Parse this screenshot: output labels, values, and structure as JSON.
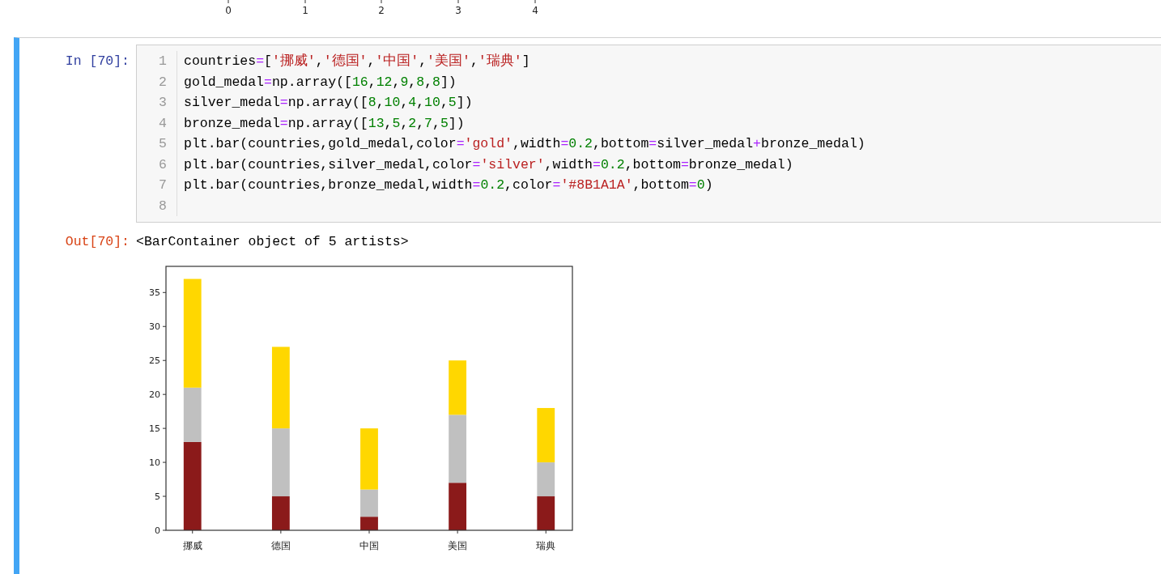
{
  "previous_output": {
    "x_tick_labels": [
      "0",
      "1",
      "2",
      "3",
      "4"
    ]
  },
  "cell": {
    "input": {
      "prompt": "In [70]:",
      "lines": [
        {
          "number": "1",
          "tokens": [
            {
              "kind": "name",
              "text": "countries"
            },
            {
              "kind": "op",
              "text": "="
            },
            {
              "kind": "name",
              "text": "["
            },
            {
              "kind": "string",
              "text": "'挪威'"
            },
            {
              "kind": "name",
              "text": ","
            },
            {
              "kind": "string",
              "text": "'德国'"
            },
            {
              "kind": "name",
              "text": ","
            },
            {
              "kind": "string",
              "text": "'中国'"
            },
            {
              "kind": "name",
              "text": ","
            },
            {
              "kind": "string",
              "text": "'美国'"
            },
            {
              "kind": "name",
              "text": ","
            },
            {
              "kind": "string",
              "text": "'瑞典'"
            },
            {
              "kind": "name",
              "text": "]"
            }
          ]
        },
        {
          "number": "2",
          "tokens": [
            {
              "kind": "name",
              "text": "gold_medal"
            },
            {
              "kind": "op",
              "text": "="
            },
            {
              "kind": "name",
              "text": "np.array(["
            },
            {
              "kind": "number",
              "text": "16"
            },
            {
              "kind": "name",
              "text": ","
            },
            {
              "kind": "number",
              "text": "12"
            },
            {
              "kind": "name",
              "text": ","
            },
            {
              "kind": "number",
              "text": "9"
            },
            {
              "kind": "name",
              "text": ","
            },
            {
              "kind": "number",
              "text": "8"
            },
            {
              "kind": "name",
              "text": ","
            },
            {
              "kind": "number",
              "text": "8"
            },
            {
              "kind": "name",
              "text": "])"
            }
          ]
        },
        {
          "number": "3",
          "tokens": [
            {
              "kind": "name",
              "text": "silver_medal"
            },
            {
              "kind": "op",
              "text": "="
            },
            {
              "kind": "name",
              "text": "np.array(["
            },
            {
              "kind": "number",
              "text": "8"
            },
            {
              "kind": "name",
              "text": ","
            },
            {
              "kind": "number",
              "text": "10"
            },
            {
              "kind": "name",
              "text": ","
            },
            {
              "kind": "number",
              "text": "4"
            },
            {
              "kind": "name",
              "text": ","
            },
            {
              "kind": "number",
              "text": "10"
            },
            {
              "kind": "name",
              "text": ","
            },
            {
              "kind": "number",
              "text": "5"
            },
            {
              "kind": "name",
              "text": "])"
            }
          ]
        },
        {
          "number": "4",
          "tokens": [
            {
              "kind": "name",
              "text": "bronze_medal"
            },
            {
              "kind": "op",
              "text": "="
            },
            {
              "kind": "name",
              "text": "np.array(["
            },
            {
              "kind": "number",
              "text": "13"
            },
            {
              "kind": "name",
              "text": ","
            },
            {
              "kind": "number",
              "text": "5"
            },
            {
              "kind": "name",
              "text": ","
            },
            {
              "kind": "number",
              "text": "2"
            },
            {
              "kind": "name",
              "text": ","
            },
            {
              "kind": "number",
              "text": "7"
            },
            {
              "kind": "name",
              "text": ","
            },
            {
              "kind": "number",
              "text": "5"
            },
            {
              "kind": "name",
              "text": "])"
            }
          ]
        },
        {
          "number": "5",
          "tokens": [
            {
              "kind": "name",
              "text": "plt.bar(countries,gold_medal,color"
            },
            {
              "kind": "op",
              "text": "="
            },
            {
              "kind": "string",
              "text": "'gold'"
            },
            {
              "kind": "name",
              "text": ",width"
            },
            {
              "kind": "op",
              "text": "="
            },
            {
              "kind": "number",
              "text": "0.2"
            },
            {
              "kind": "name",
              "text": ",bottom"
            },
            {
              "kind": "op",
              "text": "="
            },
            {
              "kind": "name",
              "text": "silver_medal"
            },
            {
              "kind": "op",
              "text": "+"
            },
            {
              "kind": "name",
              "text": "bronze_medal)"
            }
          ]
        },
        {
          "number": "6",
          "tokens": [
            {
              "kind": "name",
              "text": "plt.bar(countries,silver_medal,color"
            },
            {
              "kind": "op",
              "text": "="
            },
            {
              "kind": "string",
              "text": "'silver'"
            },
            {
              "kind": "name",
              "text": ",width"
            },
            {
              "kind": "op",
              "text": "="
            },
            {
              "kind": "number",
              "text": "0.2"
            },
            {
              "kind": "name",
              "text": ",bottom"
            },
            {
              "kind": "op",
              "text": "="
            },
            {
              "kind": "name",
              "text": "bronze_medal)"
            }
          ]
        },
        {
          "number": "7",
          "tokens": [
            {
              "kind": "name",
              "text": "plt.bar(countries,bronze_medal,width"
            },
            {
              "kind": "op",
              "text": "="
            },
            {
              "kind": "number",
              "text": "0.2"
            },
            {
              "kind": "name",
              "text": ",color"
            },
            {
              "kind": "op",
              "text": "="
            },
            {
              "kind": "string",
              "text": "'#8B1A1A'"
            },
            {
              "kind": "name",
              "text": ",bottom"
            },
            {
              "kind": "op",
              "text": "="
            },
            {
              "kind": "number",
              "text": "0"
            },
            {
              "kind": "name",
              "text": ")"
            }
          ]
        },
        {
          "number": "8"
        }
      ]
    },
    "output": {
      "prompt": "Out[70]:",
      "text": "<BarContainer object of 5 artists>",
      "chart_data": {
        "type": "bar",
        "stacked": true,
        "categories": [
          "挪威",
          "德国",
          "中国",
          "美国",
          "瑞典"
        ],
        "series": [
          {
            "color": "#8b1a1a",
            "values": [
              13,
              5,
              2,
              7,
              5
            ]
          },
          {
            "color": "#c0c0c0",
            "values": [
              8,
              10,
              4,
              10,
              5
            ]
          },
          {
            "color": "#ffd700",
            "values": [
              16,
              12,
              9,
              8,
              8
            ]
          }
        ],
        "ylim": [
          0,
          38.85
        ],
        "yticks": [
          0,
          5,
          10,
          15,
          20,
          25,
          30,
          35
        ]
      }
    }
  }
}
